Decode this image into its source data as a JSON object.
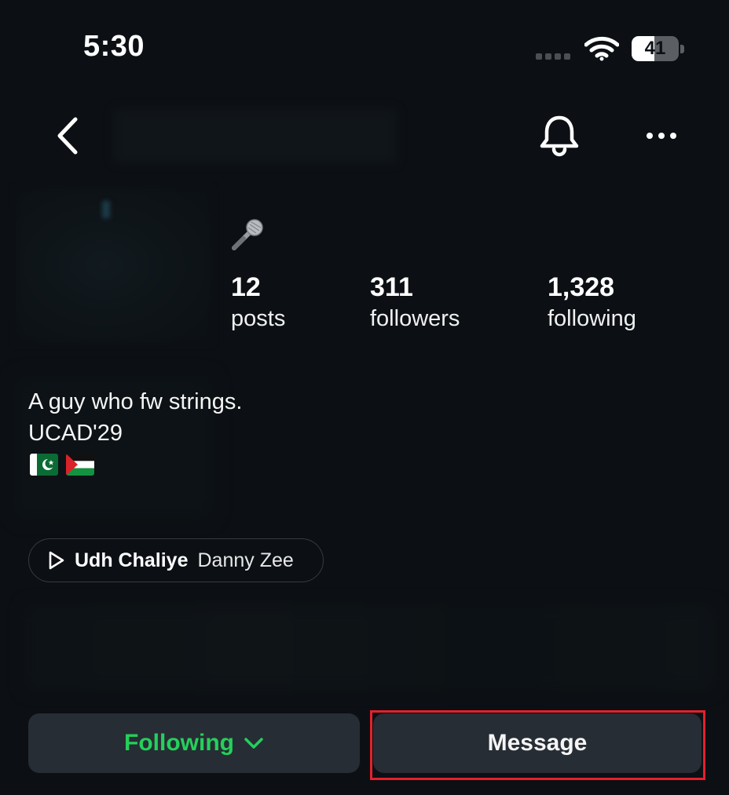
{
  "status_bar": {
    "time": "5:30",
    "battery_level": "41",
    "signal_icon": "cellular-dots-icon",
    "wifi_icon": "wifi-icon"
  },
  "header": {
    "back_icon": "chevron-left-icon",
    "notifications_icon": "bell-icon",
    "more_icon": "ellipsis-icon"
  },
  "profile": {
    "category_emoji": "🎤",
    "stats": [
      {
        "value": "12",
        "label": "posts"
      },
      {
        "value": "311",
        "label": "followers"
      },
      {
        "value": "1,328",
        "label": "following"
      }
    ],
    "bio_lines": [
      "A guy who fw strings.",
      "UCAD'29"
    ],
    "flags": [
      "pakistan-flag-icon",
      "palestine-flag-icon"
    ]
  },
  "music": {
    "title": "Udh Chaliye",
    "artist": "Danny Zee",
    "icon": "play-icon"
  },
  "actions": {
    "following_label": "Following",
    "message_label": "Message"
  },
  "colors": {
    "background": "#0c1014",
    "button_bg": "#272d35",
    "following_green": "#24d05a",
    "highlight_red": "#e5202b"
  }
}
